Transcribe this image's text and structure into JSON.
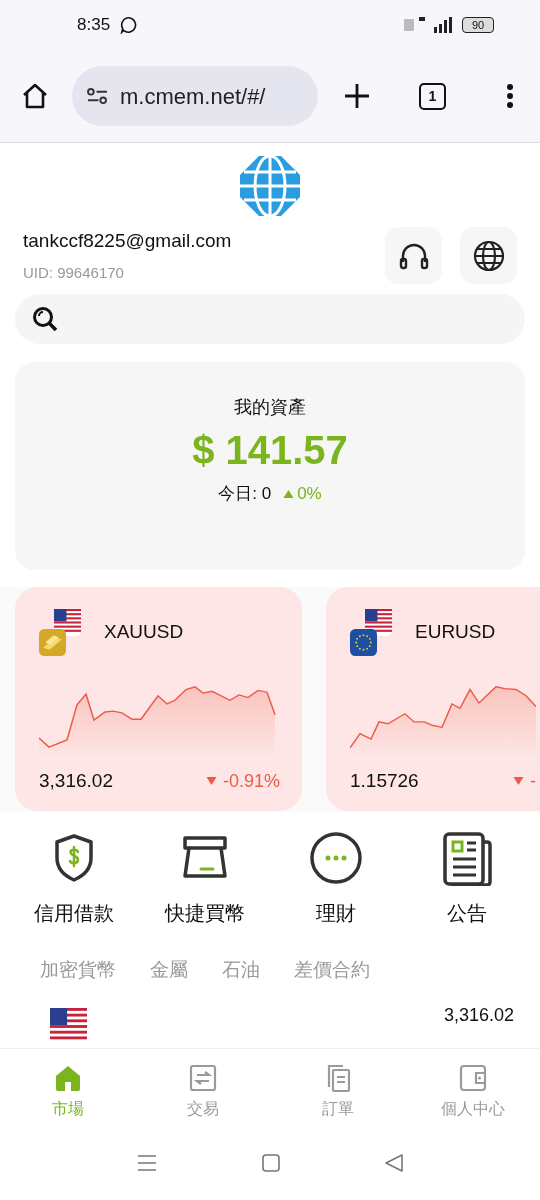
{
  "status_bar": {
    "time": "8:35",
    "battery": "90"
  },
  "browser": {
    "url": "m.cmem.net/#/",
    "tab_count": "1"
  },
  "account": {
    "email": "tankccf8225@gmail.com",
    "uid": "UID: 99646170"
  },
  "assets": {
    "title": "我的資產",
    "amount": "$ 141.57",
    "today": "今日: 0",
    "change": "0%",
    "rising": true
  },
  "market_cards": [
    {
      "symbol": "XAUUSD",
      "price": "3,316.02",
      "change": "-0.91%",
      "rising": false
    },
    {
      "symbol": "EURUSD",
      "price": "1.15726",
      "change": "-",
      "rising": false
    }
  ],
  "shortcuts": [
    {
      "label": "信用借款"
    },
    {
      "label": "快捷買幣"
    },
    {
      "label": "理財"
    },
    {
      "label": "公告"
    }
  ],
  "categories": [
    {
      "label": "加密貨幣",
      "selected": false
    },
    {
      "label": "金屬",
      "selected": false
    },
    {
      "label": "石油",
      "selected": false
    },
    {
      "label": "差價合約",
      "selected": false
    }
  ],
  "list_rows": [
    {
      "price": "3,316.02"
    }
  ],
  "bottom_nav": [
    {
      "label": "市場",
      "selected": true
    },
    {
      "label": "交易",
      "selected": false
    },
    {
      "label": "訂單",
      "selected": false
    },
    {
      "label": "個人中心",
      "selected": false
    }
  ]
}
